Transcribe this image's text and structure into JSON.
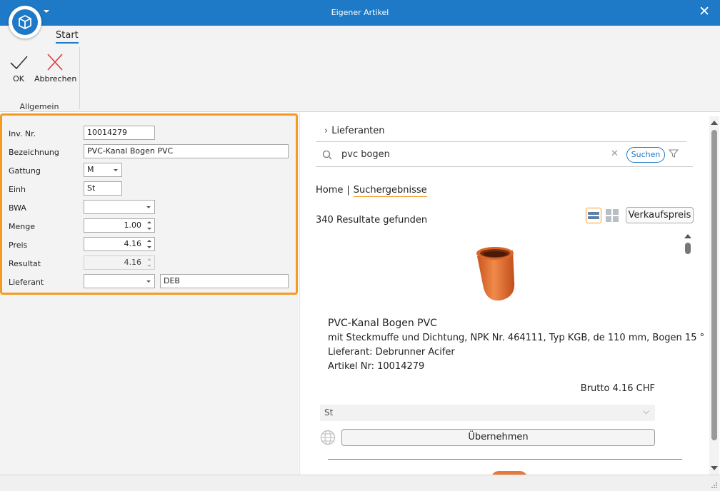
{
  "window": {
    "title": "Eigener Artikel",
    "close_glyph": "✕"
  },
  "ribbon": {
    "tab_label": "Start",
    "ok_label": "OK",
    "cancel_label": "Abbrechen",
    "group_label": "Allgemein"
  },
  "form": {
    "inv_nr": {
      "label": "Inv. Nr.",
      "value": "10014279"
    },
    "bezeichnung": {
      "label": "Bezeichnung",
      "value": "PVC-Kanal Bogen PVC"
    },
    "gattung": {
      "label": "Gattung",
      "value": "M"
    },
    "einh": {
      "label": "Einh",
      "value": "St"
    },
    "bwa": {
      "label": "BWA",
      "value": ""
    },
    "menge": {
      "label": "Menge",
      "value": "1.00"
    },
    "preis": {
      "label": "Preis",
      "value": "4.16"
    },
    "resultat": {
      "label": "Resultat",
      "value": "4.16"
    },
    "lieferant": {
      "label": "Lieferant",
      "value": "",
      "code": "DEB"
    }
  },
  "catalog": {
    "section_label": "Lieferanten",
    "search": {
      "query": "pvc bogen",
      "button_label": "Suchen"
    },
    "breadcrumb": {
      "home": "Home",
      "separator": "|",
      "current": "Suchergebnisse"
    },
    "result_count": "340 Resultate gefunden",
    "price_mode_button": "Verkaufspreis",
    "product": {
      "title": "PVC-Kanal Bogen PVC",
      "description": "mit Steckmuffe und Dichtung, NPK Nr. 464111, Typ KGB, de 110 mm, Bogen 15 °",
      "supplier": "Lieferant: Debrunner Acifer",
      "article": "Artikel Nr: 10014279",
      "price": "Brutto 4.16 CHF",
      "unit": "St",
      "take_button": "Übernehmen"
    }
  },
  "colors": {
    "titlebar": "#1e79c6",
    "highlight": "#f59c1f",
    "cancel_red": "#e03a3a",
    "pipe_orange": "#e77a3a"
  },
  "icons": [
    "app-logo-icon",
    "quick-access-dropdown-icon",
    "close-icon",
    "ok-check-icon",
    "cancel-x-icon",
    "search-icon",
    "clear-icon",
    "filter-icon",
    "list-view-icon",
    "grid-view-icon",
    "globe-icon",
    "chevron-down-icon",
    "chevron-right-icon"
  ]
}
